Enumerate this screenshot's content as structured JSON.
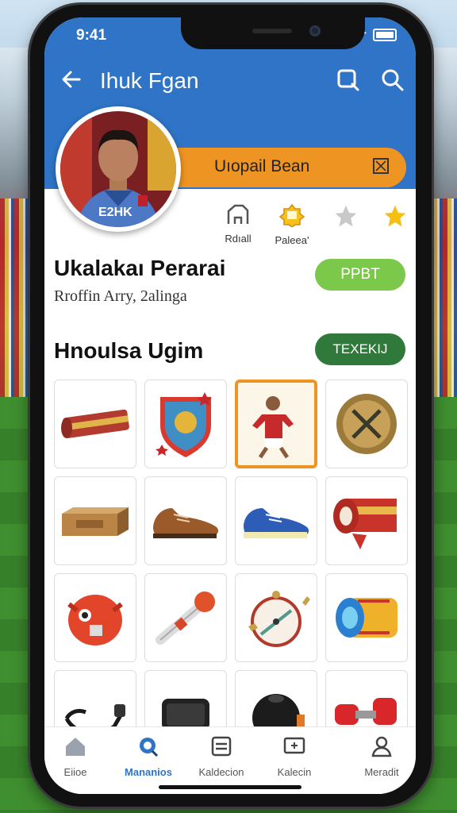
{
  "status": {
    "time": "9:41"
  },
  "header": {
    "title": "Ihuk Fgan"
  },
  "banner": {
    "label": "Uıopail Bean"
  },
  "actions": [
    {
      "label": "Rdıall",
      "icon": "profile-card-icon"
    },
    {
      "label": "Paleea'",
      "icon": "badge-icon"
    },
    {
      "label": "",
      "icon": "star-outline-icon"
    },
    {
      "label": "",
      "icon": "star-filled-icon"
    }
  ],
  "profile": {
    "name": "Ukalakaı Perarai",
    "subtitle": "Rroffin Arry, 2alinga",
    "button": "PPBT"
  },
  "section": {
    "title": "Hnoulsa Ugim",
    "button": "TEXEKIJ"
  },
  "items": [
    {
      "icon": "scarf-icon"
    },
    {
      "icon": "crest-badge-icon"
    },
    {
      "icon": "player-card-icon",
      "selected": true
    },
    {
      "icon": "medal-icon"
    },
    {
      "icon": "wooden-box-icon"
    },
    {
      "icon": "brown-shoe-icon"
    },
    {
      "icon": "blue-boot-icon"
    },
    {
      "icon": "scarf-roll-icon"
    },
    {
      "icon": "red-mascot-icon"
    },
    {
      "icon": "torch-icon"
    },
    {
      "icon": "compass-icon"
    },
    {
      "icon": "tape-roll-icon"
    },
    {
      "icon": "strap-icon"
    },
    {
      "icon": "phone-device-icon"
    },
    {
      "icon": "black-ball-icon"
    },
    {
      "icon": "dumbbell-icon"
    }
  ],
  "tabs": [
    {
      "label": "Eiioe",
      "icon": "home-icon"
    },
    {
      "label": "Mananios",
      "icon": "search-badge-icon",
      "active": true
    },
    {
      "label": "Kaldecion",
      "icon": "collection-icon"
    },
    {
      "label": "Kalecin",
      "icon": "card-icon"
    },
    {
      "label": "Meradit",
      "icon": "user-icon"
    }
  ],
  "colors": {
    "primary": "#2f74c6",
    "accent": "#ee9422",
    "green": "#7cc84a",
    "dark_green": "#2f7a3a"
  }
}
